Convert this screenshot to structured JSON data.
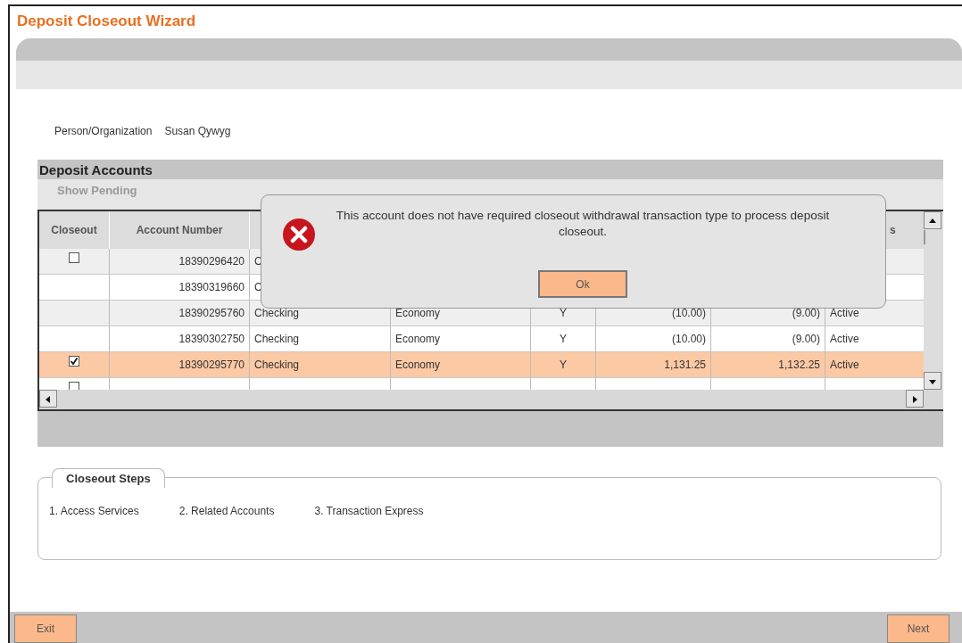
{
  "window": {
    "title": "Deposit Closeout Wizard"
  },
  "person": {
    "label": "Person/Organization",
    "value": "Susan Qywyg"
  },
  "deposit_accounts": {
    "title": "Deposit Accounts",
    "show_pending": "Show Pending",
    "table": {
      "column_headers": {
        "column_1": "Closeout",
        "column_2": "Account Number",
        "column_8": "s"
      },
      "rows": [
        {
          "checked": false,
          "selected": false,
          "column_2": "18390296420",
          "column_3": "C"
        },
        {
          "selected": false,
          "column_2": "18390319660",
          "column_3": "C"
        },
        {
          "selected": false,
          "column_2": "18390295760",
          "column_3": "Checking",
          "column_4": "Economy",
          "column_5": "Y",
          "column_6": "(10.00)",
          "column_7": "(9.00)",
          "column_8": "Active"
        },
        {
          "selected": false,
          "column_2": "18390302750",
          "column_3": "Checking",
          "column_4": "Economy",
          "column_5": "Y",
          "column_6": "(10.00)",
          "column_7": "(9.00)",
          "column_8": "Active"
        },
        {
          "checked": true,
          "selected": true,
          "column_2": "18390295770",
          "column_3": "Checking",
          "column_4": "Economy",
          "column_5": "Y",
          "column_6": "1,131.25",
          "column_7": "1,132.25",
          "column_8": "Active"
        },
        {
          "checked": false,
          "selected": false
        }
      ]
    }
  },
  "dialog": {
    "message": "This account does not have required closeout withdrawal transaction type to process deposit closeout.",
    "button": "Ok"
  },
  "closeout_steps": {
    "title": "Closeout Steps",
    "items": [
      "1. Access Services",
      "2. Related Accounts",
      "3. Transaction Express"
    ]
  },
  "footer": {
    "buttons": [
      "Exit",
      "Next"
    ]
  }
}
